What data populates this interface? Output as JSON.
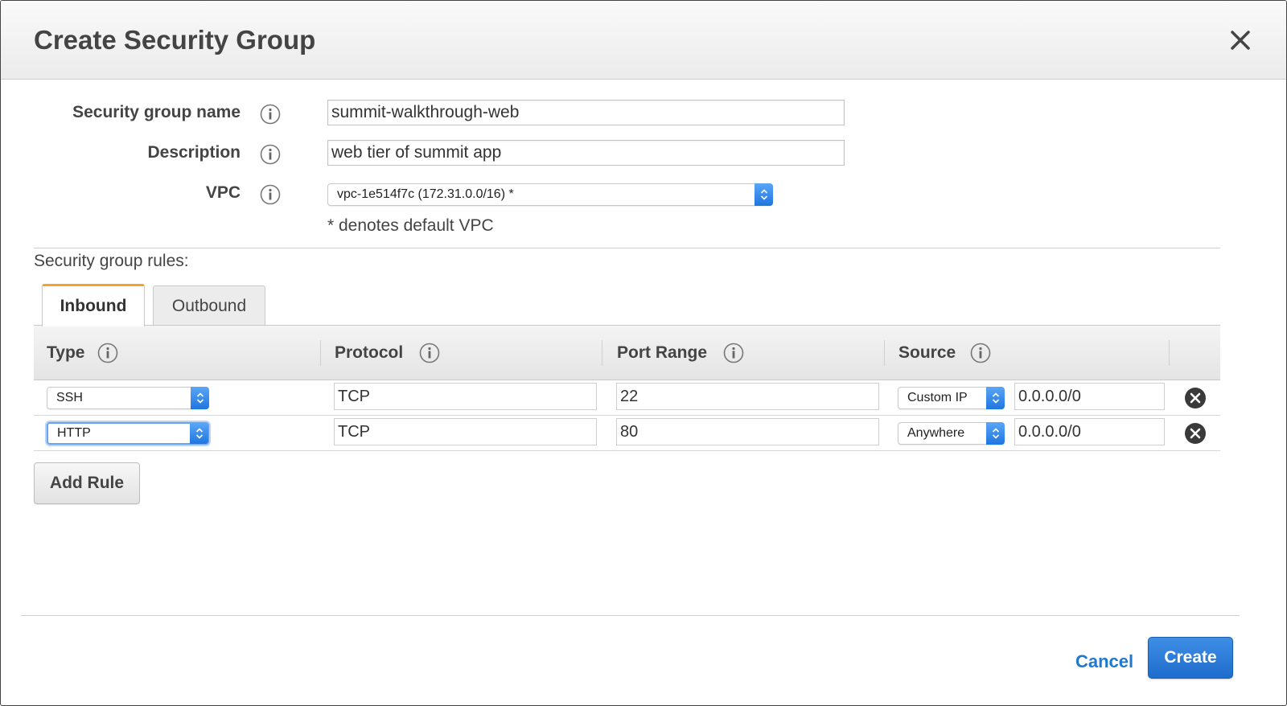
{
  "dialog": {
    "title": "Create Security Group",
    "close_icon": "close-icon"
  },
  "form": {
    "name_label": "Security group name",
    "name_value": "summit-walkthrough-web",
    "description_label": "Description",
    "description_value": "web tier of summit app",
    "vpc_label": "VPC",
    "vpc_value": "vpc-1e514f7c (172.31.0.0/16) *",
    "vpc_note": "* denotes default VPC",
    "info_icon": "info-icon"
  },
  "rules": {
    "label": "Security group rules:",
    "tabs": [
      {
        "label": "Inbound",
        "active": true
      },
      {
        "label": "Outbound",
        "active": false
      }
    ],
    "columns": [
      "Type",
      "Protocol",
      "Port Range",
      "Source"
    ],
    "rows": [
      {
        "type": "SSH",
        "protocol": "TCP",
        "port": "22",
        "source_type": "Custom IP",
        "source_value": "0.0.0.0/0"
      },
      {
        "type": "HTTP",
        "protocol": "TCP",
        "port": "80",
        "source_type": "Anywhere",
        "source_value": "0.0.0.0/0"
      }
    ],
    "add_rule_label": "Add Rule"
  },
  "footer": {
    "cancel_label": "Cancel",
    "create_label": "Create"
  },
  "colors": {
    "accent_blue": "#1f78d1",
    "active_tab_border": "#f3a329"
  }
}
